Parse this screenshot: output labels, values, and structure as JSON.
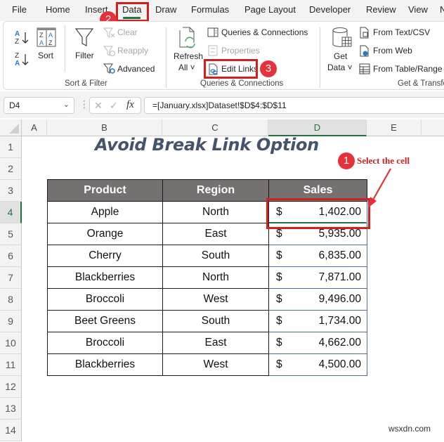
{
  "ribbon_tabs": [
    {
      "label": "File"
    },
    {
      "label": "Home"
    },
    {
      "label": "Insert"
    },
    {
      "label": "Data",
      "active": true
    },
    {
      "label": "Draw"
    },
    {
      "label": "Formulas"
    },
    {
      "label": "Page Layout"
    },
    {
      "label": "Developer"
    },
    {
      "label": "Review"
    },
    {
      "label": "View"
    }
  ],
  "ribbon": {
    "sort_filter": {
      "sort_az_icon": "sort-a-to-z-icon",
      "sort_za_icon": "sort-z-to-a-icon",
      "sort": "Sort",
      "filter": "Filter",
      "clear": "Clear",
      "reapply": "Reapply",
      "advanced": "Advanced",
      "group_label": "Sort & Filter"
    },
    "queries": {
      "refresh_line1": "Refresh",
      "refresh_line2": "All ˅",
      "queries_connections": "Queries & Connections",
      "properties": "Properties",
      "edit_links": "Edit Links",
      "group_label": "Queries & Connections"
    },
    "get_transform": {
      "get_line1": "Get",
      "get_line2": "Data ˅",
      "from_text_csv": "From Text/CSV",
      "from_web": "From Web",
      "from_table_range": "From Table/Range",
      "group_label": "Get & Transfo"
    }
  },
  "formula_bar": {
    "name_box": "D4",
    "cancel_icon": "✕",
    "enter_icon": "✓",
    "fx": "fx",
    "formula": "=[January.xlsx]Dataset!$D$4:$D$11"
  },
  "columns": [
    "A",
    "B",
    "C",
    "D",
    "E"
  ],
  "selected_column": "D",
  "rows": [
    "1",
    "2",
    "3",
    "4",
    "5",
    "6",
    "7",
    "8",
    "9",
    "10",
    "11",
    "12",
    "13",
    "14"
  ],
  "selected_row": "4",
  "sheet": {
    "title": "Avoid Break Link Option",
    "headers": {
      "product": "Product",
      "region": "Region",
      "sales": "Sales"
    },
    "currency": "$",
    "records": [
      {
        "product": "Apple",
        "region": "North",
        "sales": "1,402.00"
      },
      {
        "product": "Orange",
        "region": "East",
        "sales": "5,935.00"
      },
      {
        "product": "Cherry",
        "region": "South",
        "sales": "6,835.00"
      },
      {
        "product": "Blackberries",
        "region": "North",
        "sales": "7,871.00"
      },
      {
        "product": "Broccoli",
        "region": "West",
        "sales": "9,496.00"
      },
      {
        "product": "Beet Greens",
        "region": "South",
        "sales": "1,734.00"
      },
      {
        "product": "Broccoli",
        "region": "East",
        "sales": "4,662.00"
      },
      {
        "product": "Blackberries",
        "region": "West",
        "sales": "4,500.00"
      }
    ]
  },
  "annotations": {
    "step1_number": "1",
    "step1_text": "Select the cell",
    "step2_number": "2",
    "step3_number": "3",
    "color": "#d21f1f"
  },
  "watermark": "wsxdn.com",
  "colors": {
    "excel_green": "#217346",
    "header_fill": "#767171",
    "title_color": "#44546a"
  }
}
